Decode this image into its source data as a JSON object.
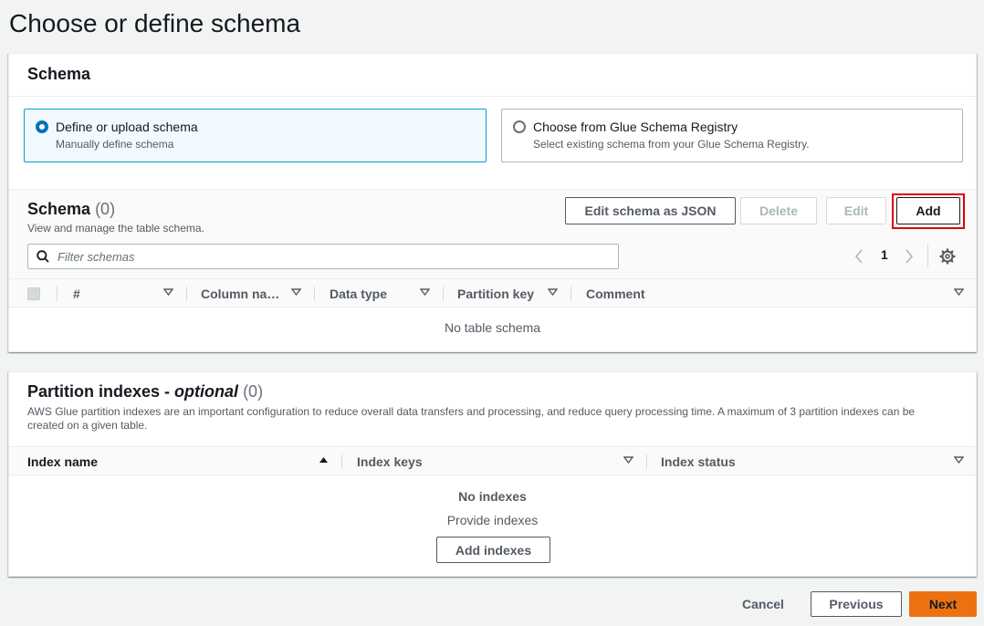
{
  "page": {
    "title": "Choose or define schema"
  },
  "schema_card": {
    "title": "Schema",
    "options": [
      {
        "title": "Define or upload schema",
        "subtitle": "Manually define schema",
        "selected": true
      },
      {
        "title": "Choose from Glue Schema Registry",
        "subtitle": "Select existing schema from your Glue Schema Registry.",
        "selected": false
      }
    ]
  },
  "schema_table": {
    "title": "Schema",
    "count": "(0)",
    "description": "View and manage the table schema.",
    "buttons": {
      "edit_json": "Edit schema as JSON",
      "delete": "Delete",
      "edit": "Edit",
      "add": "Add"
    },
    "filter_placeholder": "Filter schemas",
    "page_number": "1",
    "columns": [
      "#",
      "Column na…",
      "Data type",
      "Partition key",
      "Comment"
    ],
    "empty_text": "No table schema"
  },
  "partition_indexes": {
    "title": "Partition indexes - ",
    "title_optional": "optional",
    "count": "(0)",
    "description": "AWS Glue partition indexes are an important configuration to reduce overall data transfers and processing, and reduce query processing time. A maximum of 3 partition indexes can be created on a given table.",
    "columns": [
      "Index name",
      "Index keys",
      "Index status"
    ],
    "empty_title": "No indexes",
    "empty_subtitle": "Provide indexes",
    "add_button": "Add indexes"
  },
  "footer": {
    "cancel": "Cancel",
    "previous": "Previous",
    "next": "Next"
  },
  "colors": {
    "primary": "#ec7211",
    "selected_border": "#00a1c9",
    "radio": "#0073bb",
    "highlight": "#e00000"
  }
}
